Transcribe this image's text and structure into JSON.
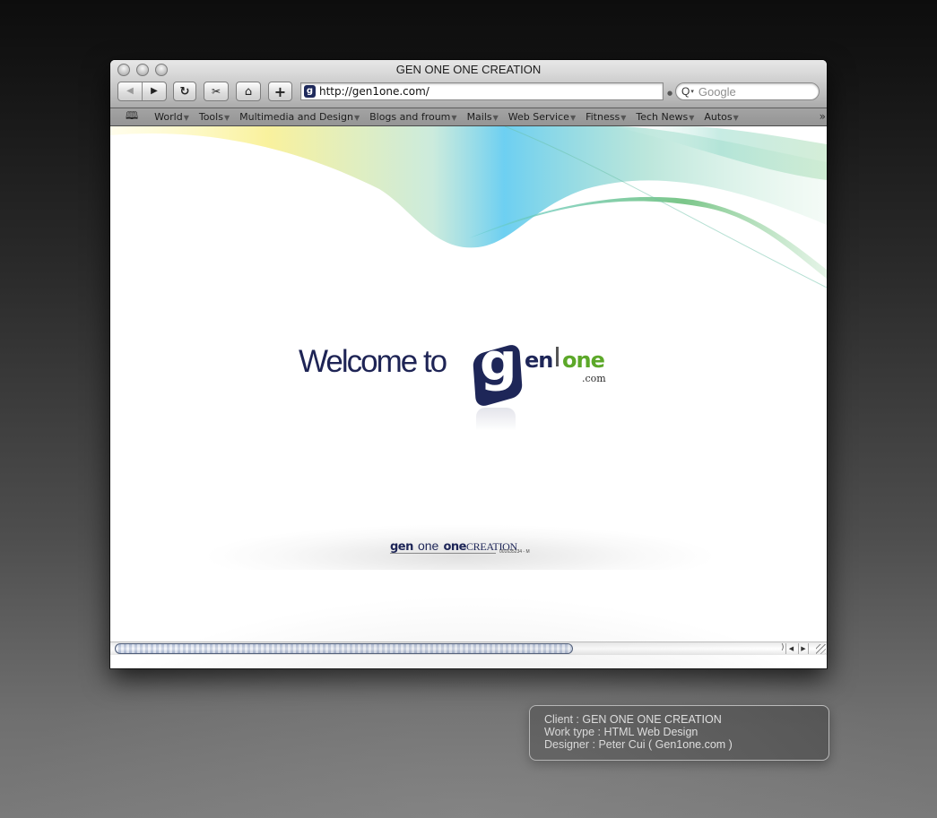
{
  "window": {
    "title": "GEN ONE ONE CREATION",
    "traffic_lights": [
      "close",
      "minimize",
      "zoom"
    ]
  },
  "toolbar": {
    "back_icon": "◀",
    "forward_icon": "▶",
    "reload_icon": "↻",
    "snip_icon": "✂",
    "home_icon": "⌂",
    "add_icon": "+",
    "url": "http://gen1one.com/",
    "favicon_letter": "g",
    "search_placeholder": "Google",
    "search_icon": "Q",
    "search_caret": "▾"
  },
  "bookmarks": {
    "book_icon": "🕮",
    "items": [
      {
        "label": "World"
      },
      {
        "label": "Tools"
      },
      {
        "label": "Multimedia and Design"
      },
      {
        "label": "Blogs and froum"
      },
      {
        "label": "Mails"
      },
      {
        "label": "Web Service"
      },
      {
        "label": "Fitness"
      },
      {
        "label": "Tech News"
      },
      {
        "label": "Autos"
      }
    ],
    "dropdown_arrow": "▼",
    "more_icon": "»"
  },
  "page": {
    "welcome": "Welcome to",
    "logo": {
      "g": "g",
      "en": "en",
      "one": "one",
      "com": ".com"
    },
    "footer_logo": {
      "gen": "gen",
      "one_light": "one",
      "one_bold": "one",
      "creation": "CREATION",
      "reg": "001635234 - M"
    },
    "colors": {
      "navy": "#1e2658",
      "green": "#5ca829"
    }
  },
  "scrollbar": {
    "left_arrow": "◀",
    "right_arrow": "▶",
    "position_fraction": 0.0,
    "visible_fraction": 0.69
  },
  "info_card": {
    "lines": [
      "Client : GEN ONE ONE CREATION",
      "Work type : HTML Web Design",
      "Designer : Peter Cui ( Gen1one.com )"
    ]
  }
}
